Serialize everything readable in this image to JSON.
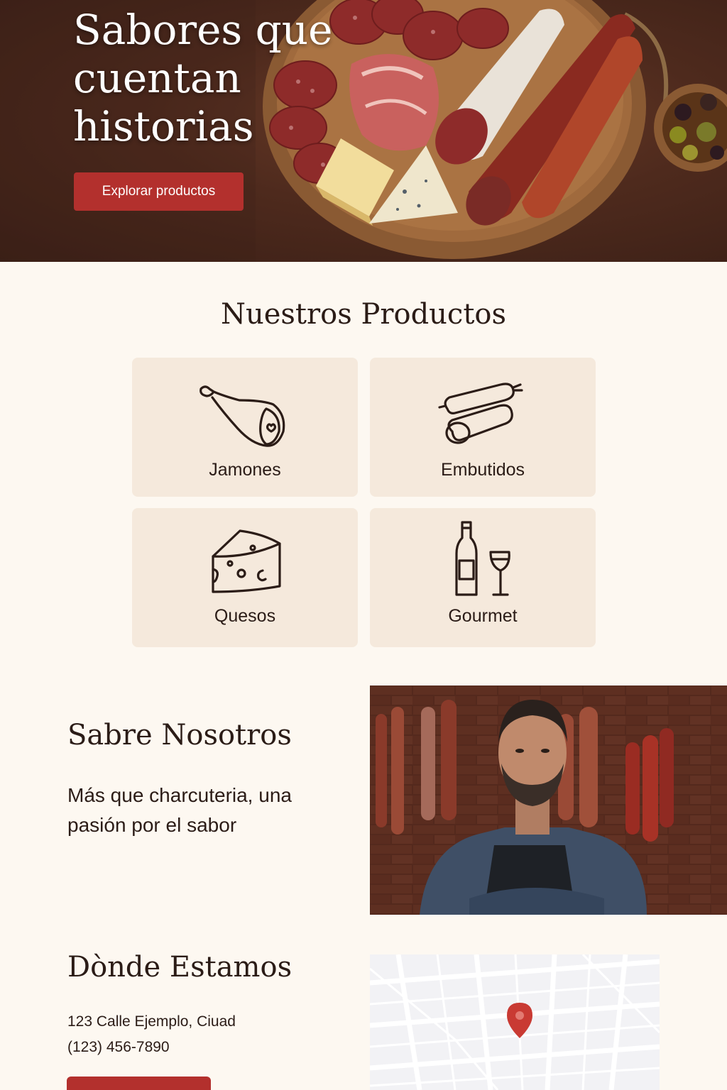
{
  "hero": {
    "title": "Sabores que cuentan historias",
    "cta_label": "Explorar productos"
  },
  "products": {
    "title": "Nuestros Productos",
    "items": [
      {
        "label": "Jamones",
        "icon": "ham-icon"
      },
      {
        "label": "Embutidos",
        "icon": "sausage-icon"
      },
      {
        "label": "Quesos",
        "icon": "cheese-icon"
      },
      {
        "label": "Gourmet",
        "icon": "wine-icon"
      }
    ]
  },
  "about": {
    "title": "Sabre Nosotros",
    "text": "Más que charcuteria, una pasión por el sabor"
  },
  "location": {
    "title": "Dònde Estamos",
    "address": "123 Calle Ejemplo, Ciuad",
    "phone": "(123) 456-7890"
  },
  "colors": {
    "accent": "#b3302d",
    "background": "#fdf8f1",
    "card": "#f5e9dc",
    "text": "#2b1c17"
  }
}
